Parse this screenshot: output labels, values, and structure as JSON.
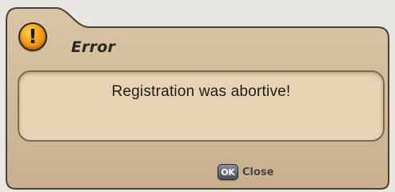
{
  "dialog": {
    "title": "Error",
    "message": "Registration was abortive!",
    "icon": "exclamation-warning-icon",
    "icon_glyph": "!",
    "close": {
      "key_label": "OK",
      "label": "Close"
    },
    "colors": {
      "frame_fill": "#cdb696",
      "panel_fill": "#e7d3b4",
      "border": "#4a4035",
      "icon_orange": "#f6a21a"
    }
  }
}
